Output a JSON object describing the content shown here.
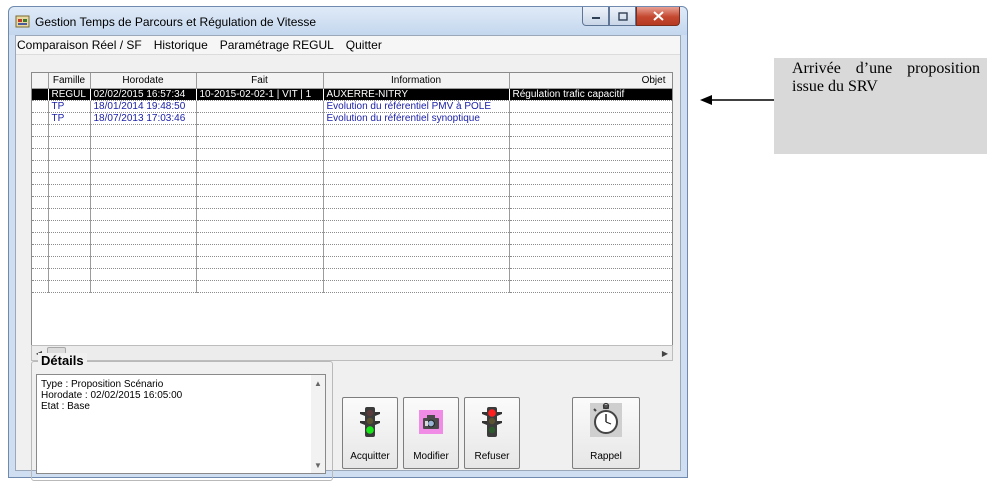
{
  "window": {
    "title": "Gestion Temps de Parcours et Régulation de Vitesse"
  },
  "menu": [
    {
      "label": "Comparaison Réel / SF"
    },
    {
      "label": "Historique"
    },
    {
      "label": "Paramétrage REGUL"
    },
    {
      "label": "Quitter"
    }
  ],
  "grid": {
    "columns": [
      "Famille",
      "Horodate",
      "Fait",
      "Information",
      "Objet"
    ],
    "rows": [
      {
        "famille": "REGUL",
        "horodate": "02/02/2015 16:57:34",
        "fait": "10-2015-02-02-1 | VIT | 1",
        "information": "AUXERRE-NITRY",
        "objet": "Régulation trafic capacitif",
        "state": "selected"
      },
      {
        "famille": "TP",
        "horodate": "18/01/2014 19:48:50",
        "fait": "",
        "information": "Evolution du référentiel PMV à POLE",
        "objet": "",
        "state": "blue"
      },
      {
        "famille": "TP",
        "horodate": "18/07/2013 17:03:46",
        "fait": "",
        "information": "Evolution du référentiel synoptique",
        "objet": "",
        "state": "blue"
      }
    ],
    "empty_rows": 14
  },
  "details": {
    "title": "Détails",
    "lines": [
      "Type : Proposition Scénario",
      "Horodate : 02/02/2015 16:05:00",
      "Etat : Base"
    ]
  },
  "buttons": {
    "acquitter": {
      "label": "Acquitter",
      "icon": "traffic-light-green-icon"
    },
    "modifier": {
      "label": "Modifier",
      "icon": "camera-icon"
    },
    "refuser": {
      "label": "Refuser",
      "icon": "traffic-light-red-icon"
    },
    "rappel": {
      "label": "Rappel",
      "icon": "stopwatch-icon"
    }
  },
  "annotation": {
    "text": "Arrivée d’une proposition issue du SRV"
  },
  "colors": {
    "selected_row_bg": "#000000",
    "link_text": "#1c20a8",
    "callout_bg": "#d9d9d9"
  }
}
